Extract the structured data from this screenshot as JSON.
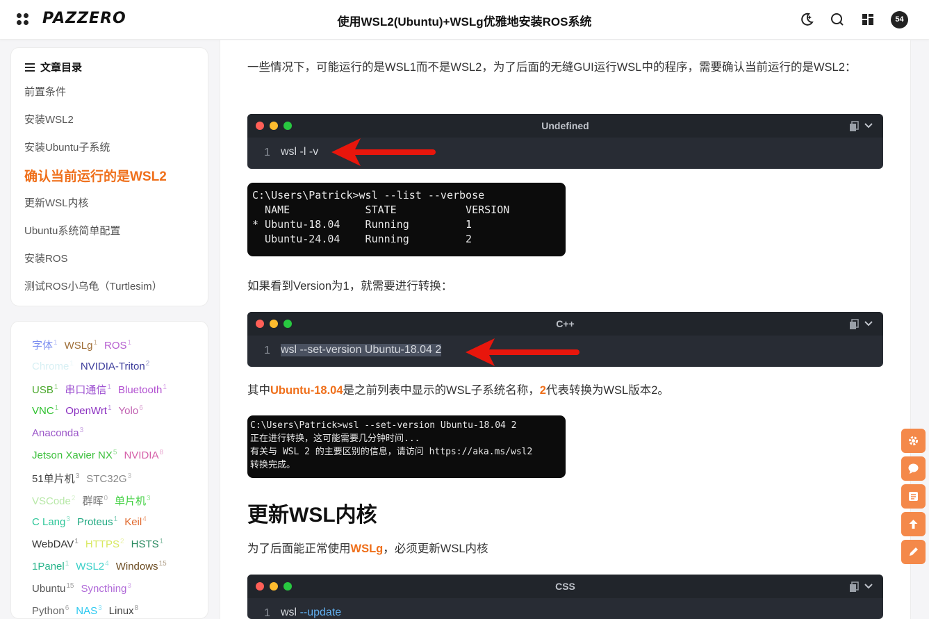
{
  "header": {
    "logo": "PAZZERO",
    "title": "使用WSL2(Ubuntu)+WSLg优雅地安装ROS系统",
    "avatar_count": "54"
  },
  "toc": {
    "heading": "文章目录",
    "items": [
      {
        "label": "前置条件"
      },
      {
        "label": "安装WSL2"
      },
      {
        "label": "安装Ubuntu子系统"
      },
      {
        "label": "确认当前运行的是WSL2"
      },
      {
        "label": "更新WSL内核"
      },
      {
        "label": "Ubuntu系统简单配置"
      },
      {
        "label": "安装ROS"
      },
      {
        "label": "测试ROS小乌龟（Turtlesim）"
      }
    ]
  },
  "tags": [
    [
      {
        "name": "字体",
        "count": "1",
        "color": "#7b8ef0"
      },
      {
        "name": "WSLg",
        "count": "1",
        "color": "#a0703a"
      },
      {
        "name": "ROS",
        "count": "1",
        "color": "#b65fd0"
      }
    ],
    [
      {
        "name": "Chrome",
        "count": "1",
        "color": "#d8f0f4"
      },
      {
        "name": "NVIDIA-Triton",
        "count": "2",
        "color": "#3a3a9a"
      }
    ],
    [
      {
        "name": "USB",
        "count": "1",
        "color": "#4aa82c"
      },
      {
        "name": "串口通信",
        "count": "1",
        "color": "#9c4fd0"
      },
      {
        "name": "Bluetooth",
        "count": "1",
        "color": "#b14fd0"
      }
    ],
    [
      {
        "name": "VNC",
        "count": "1",
        "color": "#2ec12e"
      },
      {
        "name": "OpenWrt",
        "count": "1",
        "color": "#8a2fc0"
      },
      {
        "name": "Yolo",
        "count": "6",
        "color": "#c05fb0"
      }
    ],
    [
      {
        "name": "Anaconda",
        "count": "3",
        "color": "#9a55c8"
      }
    ],
    [
      {
        "name": "Jetson Xavier NX",
        "count": "5",
        "color": "#3cc03c"
      },
      {
        "name": "NVIDIA",
        "count": "8",
        "color": "#d55fa8"
      }
    ],
    [
      {
        "name": "51单片机",
        "count": "3",
        "color": "#444444"
      },
      {
        "name": "STC32G",
        "count": "3",
        "color": "#888888"
      }
    ],
    [
      {
        "name": "VSCode",
        "count": "2",
        "color": "#b8e8a8"
      },
      {
        "name": "群晖",
        "count": "0",
        "color": "#777777"
      },
      {
        "name": "单片机",
        "count": "3",
        "color": "#40d040"
      }
    ],
    [
      {
        "name": "C Lang",
        "count": "3",
        "color": "#2fc79a"
      },
      {
        "name": "Proteus",
        "count": "1",
        "color": "#1fa880"
      },
      {
        "name": "Keil",
        "count": "4",
        "color": "#e0672a"
      }
    ],
    [
      {
        "name": "WebDAV",
        "count": "1",
        "color": "#333333"
      },
      {
        "name": "HTTPS",
        "count": "2",
        "color": "#d8e860"
      },
      {
        "name": "HSTS",
        "count": "1",
        "color": "#2a8a60"
      }
    ],
    [
      {
        "name": "1Panel",
        "count": "1",
        "color": "#2ab58c"
      },
      {
        "name": "WSL2",
        "count": "4",
        "color": "#3ad0c8"
      },
      {
        "name": "Windows",
        "count": "15",
        "color": "#6a4a20"
      }
    ],
    [
      {
        "name": "Ubuntu",
        "count": "15",
        "color": "#555555"
      },
      {
        "name": "Syncthing",
        "count": "3",
        "color": "#b06ad8"
      }
    ],
    [
      {
        "name": "Python",
        "count": "6",
        "color": "#666666"
      },
      {
        "name": "NAS",
        "count": "3",
        "color": "#2ac8f0"
      },
      {
        "name": "Linux",
        "count": "8",
        "color": "#444444"
      }
    ]
  ],
  "content": {
    "para1": "一些情况下，可能运行的是WSL1而不是WSL2，为了后面的无缝GUI运行WSL中的程序，需要确认当前运行的是WSL2：",
    "code1": {
      "lang": "Undefined",
      "line_no": "1",
      "code": "wsl -l -v"
    },
    "term1": "C:\\Users\\Patrick>wsl --list --verbose\n  NAME            STATE           VERSION\n* Ubuntu-18.04    Running         1\n  Ubuntu-24.04    Running         2",
    "para2": "如果看到Version为1，就需要进行转换：",
    "code2": {
      "lang": "C++",
      "line_no": "1",
      "code": "wsl --set-version Ubuntu-18.04 2"
    },
    "para3_pre": "其中",
    "para3_hl1": "Ubuntu-18.04",
    "para3_mid": "是之前列表中显示的WSL子系统名称，",
    "para3_hl2": "2",
    "para3_post": "代表转换为WSL版本2。",
    "term2": "C:\\Users\\Patrick>wsl --set-version Ubuntu-18.04 2\n正在进行转换，这可能需要几分钟时间...\n有关与 WSL 2 的主要区别的信息，请访问 https://aka.ms/wsl2\n转换完成。",
    "heading": "更新WSL内核",
    "para4_pre": "为了后面能正常使用",
    "para4_hl": "WSLg",
    "para4_post": "，必须更新WSL内核",
    "code3": {
      "lang": "CSS",
      "line_no": "1",
      "code_cmd": "wsl",
      "code_flag": "--update"
    }
  },
  "colors": {
    "accent": "#ef6f1a",
    "float_button": "#f4894a",
    "code_bg": "#282c34"
  },
  "icons": [
    "menu-grid-icon",
    "moon-icon",
    "search-icon",
    "apps-icon",
    "list-icon",
    "copy-icon",
    "chevron-down-icon",
    "gear-icon",
    "comment-icon",
    "document-icon",
    "arrow-up-icon",
    "pencil-icon"
  ]
}
